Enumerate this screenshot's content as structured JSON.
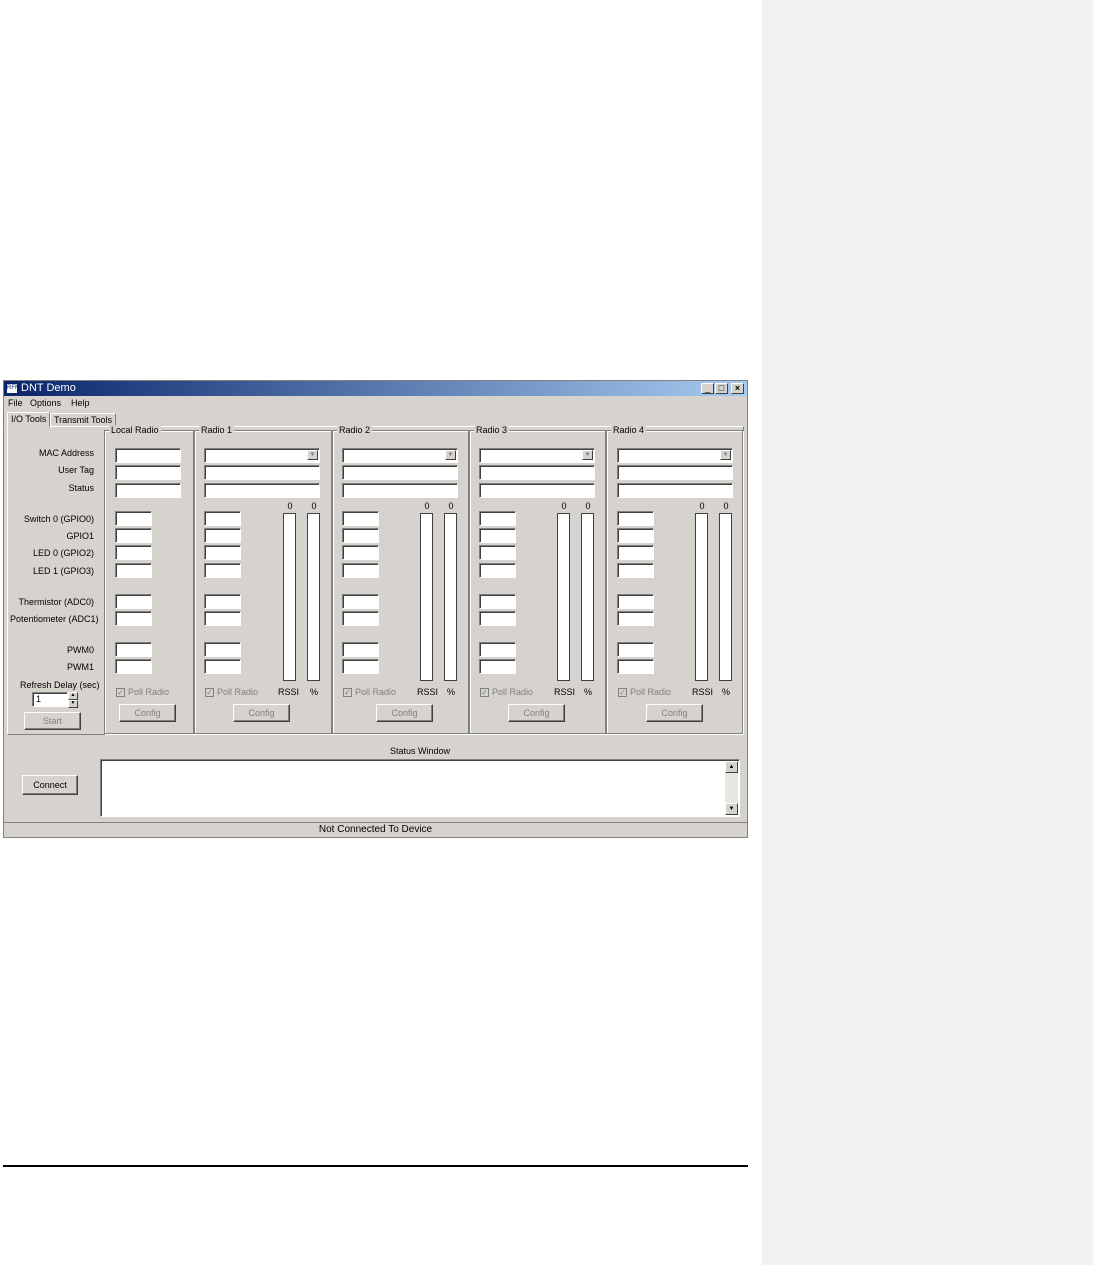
{
  "window": {
    "title": "DNT Demo",
    "icon_label": "RFM"
  },
  "menu": [
    "File",
    "Options",
    "Help"
  ],
  "tabs": [
    "I/O Tools",
    "Transmit Tools"
  ],
  "row_labels": {
    "mac_address": "MAC Address",
    "user_tag": "User Tag",
    "status": "Status",
    "switch0": "Switch 0 (GPIO0)",
    "gpio1": "GPIO1",
    "led0": "LED 0 (GPIO2)",
    "led1": "LED 1 (GPIO3)",
    "thermistor": "Thermistor (ADC0)",
    "potentiometer": "Potentiometer (ADC1)",
    "pwm0": "PWM0",
    "pwm1": "PWM1"
  },
  "refresh": {
    "label": "Refresh Delay (sec)",
    "value": "1",
    "start_label": "Start"
  },
  "groups": [
    {
      "title": "Local Radio",
      "poll_label": "Poll Radio",
      "config_label": "Config"
    },
    {
      "title": "Radio 1",
      "poll_label": "Poll Radio",
      "config_label": "Config",
      "rssi_value": "0",
      "pct_value": "0",
      "rssi_label": "RSSI",
      "pct_label": "%"
    },
    {
      "title": "Radio 2",
      "poll_label": "Poll Radio",
      "config_label": "Config",
      "rssi_value": "0",
      "pct_value": "0",
      "rssi_label": "RSSI",
      "pct_label": "%"
    },
    {
      "title": "Radio 3",
      "poll_label": "Poll Radio",
      "config_label": "Config",
      "rssi_value": "0",
      "pct_value": "0",
      "rssi_label": "RSSI",
      "pct_label": "%"
    },
    {
      "title": "Radio 4",
      "poll_label": "Poll Radio",
      "config_label": "Config",
      "rssi_value": "0",
      "pct_value": "0",
      "rssi_label": "RSSI",
      "pct_label": "%"
    }
  ],
  "connect_label": "Connect",
  "status_window": {
    "title": "Status Window",
    "text": ""
  },
  "statusbar": "Not Connected To Device"
}
